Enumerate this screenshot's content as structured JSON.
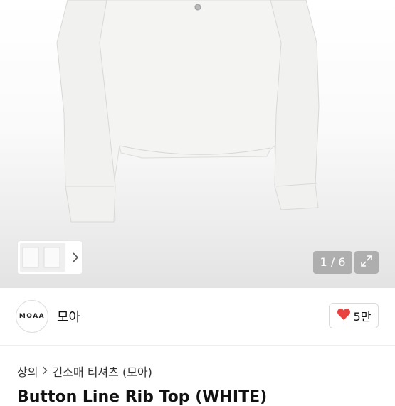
{
  "gallery": {
    "counter": "1 / 6",
    "expand_icon": "expand-icon",
    "thumb_chevron_icon": "chevron-right-icon"
  },
  "seller": {
    "avatar_text": "MOAA",
    "name": "모아"
  },
  "like": {
    "icon": "heart-icon",
    "color": "#e8413f",
    "count": "5만"
  },
  "breadcrumb": {
    "items": [
      "상의",
      "긴소매 티셔츠 (모아)"
    ],
    "separator_icon": "chevron-right-icon"
  },
  "product": {
    "title": "Button Line Rib Top (WHITE)"
  }
}
